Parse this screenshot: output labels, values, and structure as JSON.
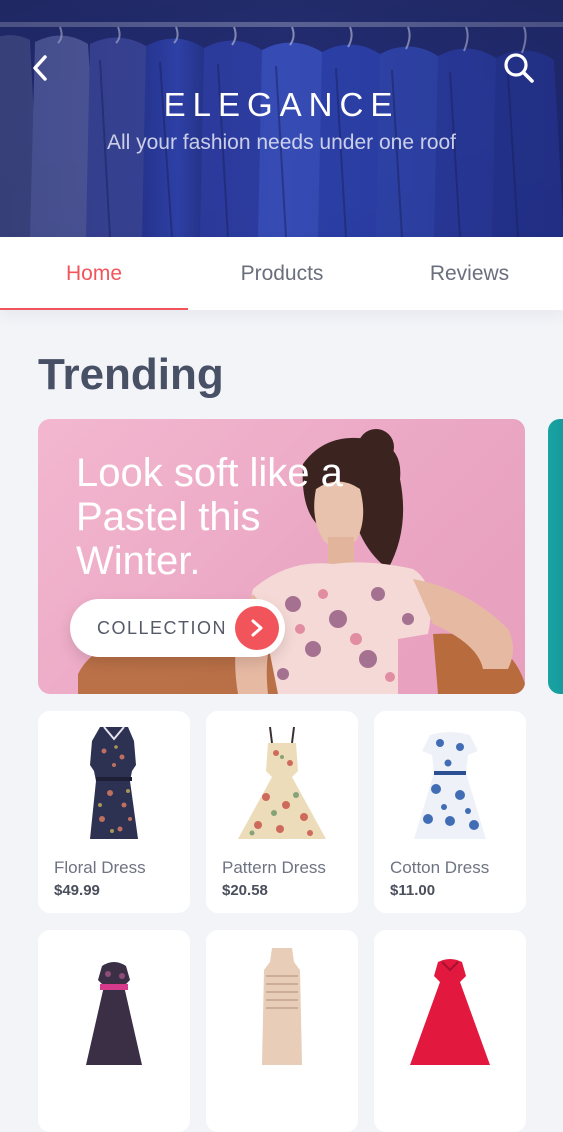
{
  "header": {
    "brand": "ELEGANCE",
    "tagline": "All your fashion needs under one roof"
  },
  "tabs": [
    {
      "label": "Home",
      "active": true
    },
    {
      "label": "Products",
      "active": false
    },
    {
      "label": "Reviews",
      "active": false
    }
  ],
  "trending": {
    "title": "Trending",
    "banner": {
      "headline": "Look soft like a Pastel this Winter.",
      "button_label": "COLLECTION"
    }
  },
  "products": [
    {
      "name": "Floral Dress",
      "price": "$49.99"
    },
    {
      "name": "Pattern Dress",
      "price": "$20.58"
    },
    {
      "name": "Cotton Dress",
      "price": "$11.00"
    },
    {
      "name": "",
      "price": ""
    },
    {
      "name": "",
      "price": ""
    },
    {
      "name": "",
      "price": ""
    }
  ],
  "colors": {
    "accent": "#f2545b",
    "header_blue": "#1f2b78",
    "heading": "#475065",
    "background": "#f3f4f8"
  },
  "icons": {
    "back": "chevron-left-icon",
    "search": "search-icon",
    "collection_arrow": "chevron-right-icon"
  }
}
